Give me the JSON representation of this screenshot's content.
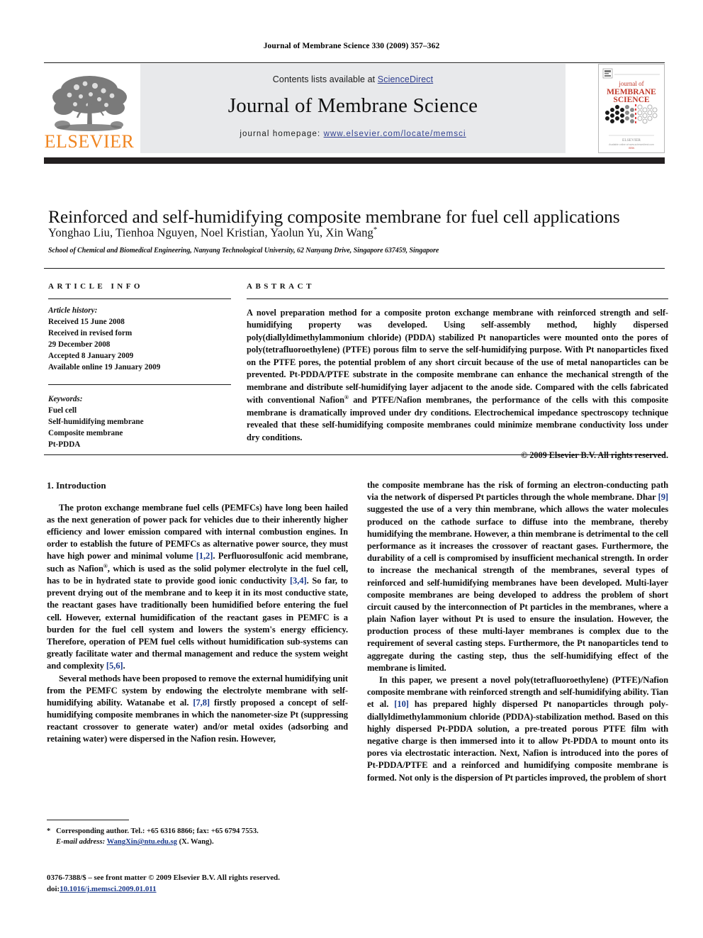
{
  "running_head": "Journal of Membrane Science 330 (2009) 357–362",
  "header": {
    "contents_prefix": "Contents lists available at ",
    "sciencedirect": "ScienceDirect",
    "journal_title": "Journal of Membrane Science",
    "homepage_prefix": "journal homepage: ",
    "homepage_url": "www.elsevier.com/locate/memsci",
    "publisher_logo": "elsevier-tree-logo",
    "publisher_name": "ELSEVIER",
    "cover": {
      "line1": "journal of",
      "line2": "MEMBRANE",
      "line3": "SCIENCE",
      "footer": "ELSEVIER"
    },
    "link_color": "#2f3f8f",
    "panel_bg": "#e8e9eb",
    "bar_color": "#231f20"
  },
  "article": {
    "title": "Reinforced and self-humidifying composite membrane for fuel cell applications",
    "authors": "Yonghao Liu, Tienhoa Nguyen, Noel Kristian, Yaolun Yu, Xin Wang",
    "corresponding_marker": "*",
    "affiliation": "School of Chemical and Biomedical Engineering, Nanyang Technological University, 62 Nanyang Drive, Singapore 637459, Singapore"
  },
  "article_info": {
    "heading": "ARTICLE INFO",
    "history_label": "Article history:",
    "history": [
      "Received 15 June 2008",
      "Received in revised form",
      "29 December 2008",
      "Accepted 8 January 2009",
      "Available online 19 January 2009"
    ],
    "keywords_label": "Keywords:",
    "keywords": [
      "Fuel cell",
      "Self-humidifying membrane",
      "Composite membrane",
      "Pt-PDDA"
    ]
  },
  "abstract": {
    "heading": "ABSTRACT",
    "text": "A novel preparation method for a composite proton exchange membrane with reinforced strength and self-humidifying property was developed. Using self-assembly method, highly dispersed poly(diallyldimethylammonium chloride) (PDDA) stabilized Pt nanoparticles were mounted onto the pores of poly(tetrafluoroethylene) (PTFE) porous film to serve the self-humidifying purpose. With Pt nanoparticles fixed on the PTFE pores, the potential problem of any short circuit because of the use of metal nanoparticles can be prevented. Pt-PDDA/PTFE substrate in the composite membrane can enhance the mechanical strength of the membrane and distribute self-humidifying layer adjacent to the anode side. Compared with the cells fabricated with conventional Nafion® and PTFE/Nafion membranes, the performance of the cells with this composite membrane is dramatically improved under dry conditions. Electrochemical impedance spectroscopy technique revealed that these self-humidifying composite membranes could minimize membrane conductivity loss under dry conditions.",
    "copyright": "© 2009 Elsevier B.V. All rights reserved."
  },
  "body": {
    "section_heading": "1. Introduction",
    "left_paragraphs": [
      "The proton exchange membrane fuel cells (PEMFCs) have long been hailed as the next generation of power pack for vehicles due to their inherently higher efficiency and lower emission compared with internal combustion engines. In order to establish the future of PEMFCs as alternative power source, they must have high power and minimal volume [1,2]. Perfluorosulfonic acid membrane, such as Nafion®, which is used as the solid polymer electrolyte in the fuel cell, has to be in hydrated state to provide good ionic conductivity [3,4]. So far, to prevent drying out of the membrane and to keep it in its most conductive state, the reactant gases have traditionally been humidified before entering the fuel cell. However, external humidification of the reactant gases in PEMFC is a burden for the fuel cell system and lowers the system's energy efficiency. Therefore, operation of PEM fuel cells without humidification sub-systems can greatly facilitate water and thermal management and reduce the system weight and complexity [5,6].",
      "Several methods have been proposed to remove the external humidifying unit from the PEMFC system by endowing the electrolyte membrane with self-humidifying ability. Watanabe et al. [7,8] firstly proposed a concept of self-humidifying composite membranes in which the nanometer-size Pt (suppressing reactant crossover to generate water) and/or metal oxides (adsorbing and retaining water) were dispersed in the Nafion resin. However,"
    ],
    "right_paragraphs": [
      "the composite membrane has the risk of forming an electron-conducting path via the network of dispersed Pt particles through the whole membrane. Dhar [9] suggested the use of a very thin membrane, which allows the water molecules produced on the cathode surface to diffuse into the membrane, thereby humidifying the membrane. However, a thin membrane is detrimental to the cell performance as it increases the crossover of reactant gases. Furthermore, the durability of a cell is compromised by insufficient mechanical strength. In order to increase the mechanical strength of the membranes, several types of reinforced and self-humidifying membranes have been developed. Multi-layer composite membranes are being developed to address the problem of short circuit caused by the interconnection of Pt particles in the membranes, where a plain Nafion layer without Pt is used to ensure the insulation. However, the production process of these multi-layer membranes is complex due to the requirement of several casting steps. Furthermore, the Pt nanoparticles tend to aggregate during the casting step, thus the self-humidifying effect of the membrane is limited.",
      "In this paper, we present a novel poly(tetrafluoroethylene) (PTFE)/Nafion composite membrane with reinforced strength and self-humidifying ability. Tian et al. [10] has prepared highly dispersed Pt nanoparticles through poly-diallyldimethylammonium chloride (PDDA)-stabilization method. Based on this highly dispersed Pt-PDDA solution, a pre-treated porous PTFE film with negative charge is then immersed into it to allow Pt-PDDA to mount onto its pores via electrostatic interaction. Next, Nafion is introduced into the pores of Pt-PDDA/PTFE and a reinforced and humidifying composite membrane is formed. Not only is the dispersion of Pt particles improved, the problem of short"
    ],
    "reference_color": "#1b3a8c"
  },
  "footnotes": {
    "corresponding_star": "*",
    "corresponding_text": "Corresponding author. Tel.: +65 6316 8866; fax: +65 6794 7553.",
    "email_label": "E-mail address:",
    "email": "WangXin@ntu.edu.sg",
    "email_owner": "(X. Wang).",
    "issn_line": "0376-7388/$ – see front matter © 2009 Elsevier B.V. All rights reserved.",
    "doi_label": "doi:",
    "doi": "10.1016/j.memsci.2009.01.011"
  }
}
